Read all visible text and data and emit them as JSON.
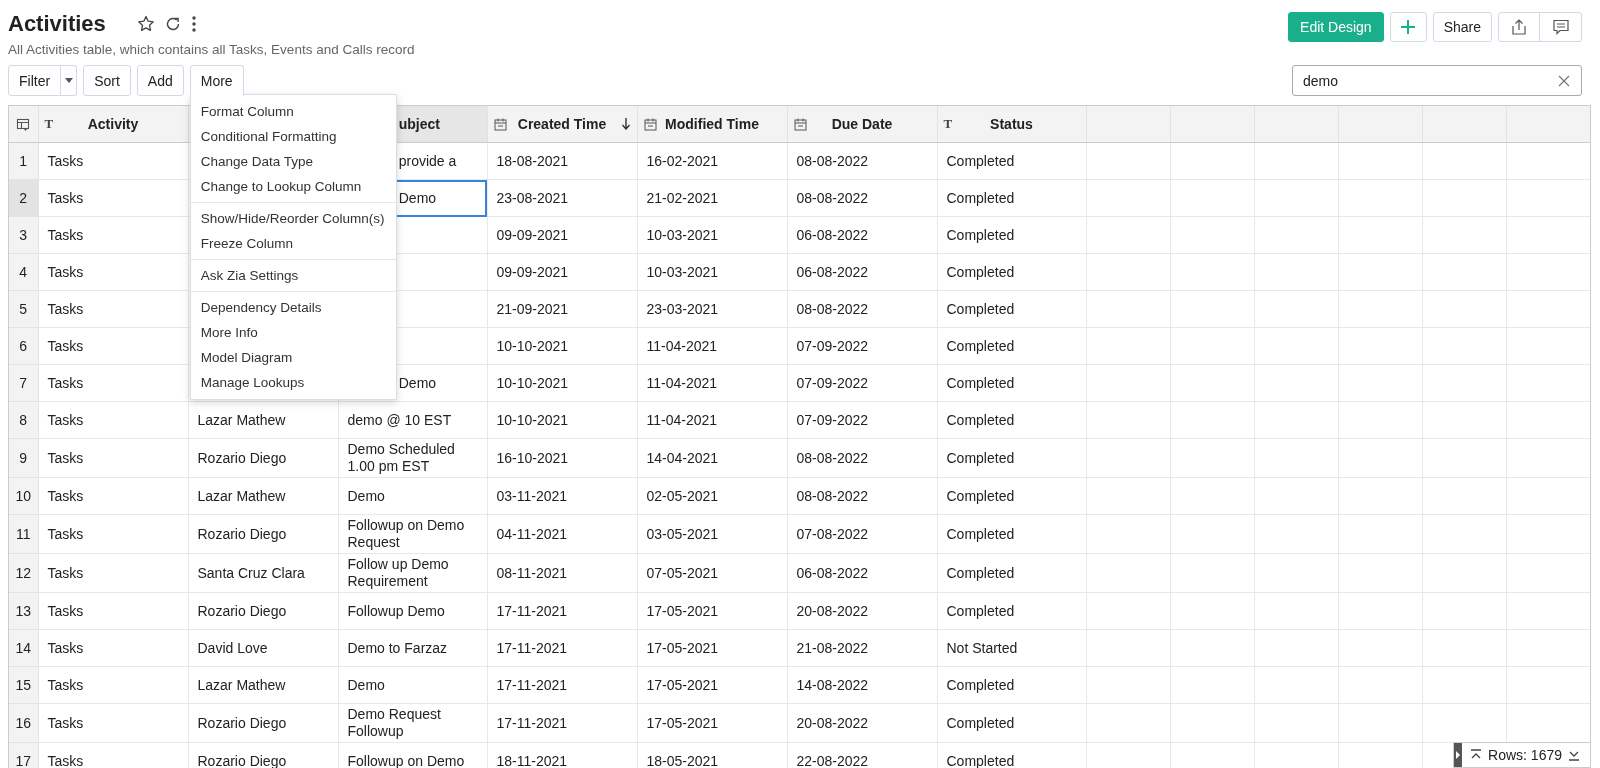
{
  "page": {
    "title": "Activities",
    "subtitle": "All Activities table, which contains all Tasks, Events and Calls record"
  },
  "header_buttons": {
    "edit_design": "Edit Design",
    "share": "Share"
  },
  "toolbar": {
    "buttons": [
      {
        "label": "Filter",
        "kind": "split",
        "open": false
      },
      {
        "label": "Sort",
        "kind": "plain",
        "open": false
      },
      {
        "label": "Add",
        "kind": "plain",
        "open": false
      },
      {
        "label": "More",
        "kind": "plain",
        "open": true
      }
    ],
    "search": {
      "value": "demo"
    }
  },
  "more_menu": {
    "groups": [
      [
        "Format Column",
        "Conditional Formatting",
        "Change Data Type",
        "Change to Lookup Column"
      ],
      [
        "Show/Hide/Reorder Column(s)",
        "Freeze Column"
      ],
      [
        "Ask Zia Settings"
      ],
      [
        "Dependency Details",
        "More Info",
        "Model Diagram",
        "Manage Lookups"
      ]
    ]
  },
  "table": {
    "columns": [
      {
        "label": "Activity",
        "kind": "text",
        "type_glyph": "T",
        "selected": false
      },
      {
        "label": "ubject",
        "selected": true
      },
      {
        "label": "Created Time",
        "kind": "date",
        "selected": false,
        "sort_descending": true
      },
      {
        "label": "Modified Time",
        "kind": "date",
        "selected": false
      },
      {
        "label": "Due Date",
        "kind": "date",
        "selected": false
      },
      {
        "label": "Status",
        "kind": "text",
        "type_glyph": "T",
        "selected": false
      }
    ],
    "rows": [
      {
        "number": "1",
        "selected": false,
        "activity": "Tasks",
        "subject": "provide a",
        "created_time": "18-08-2021",
        "modified_time": "16-02-2021",
        "due_date": "08-08-2022",
        "status": "Completed"
      },
      {
        "number": "2",
        "selected": true,
        "activity": "Tasks",
        "subject": "Demo",
        "created_time": "23-08-2021",
        "modified_time": "21-02-2021",
        "due_date": "08-08-2022",
        "status": "Completed"
      },
      {
        "number": "3",
        "selected": false,
        "activity": "Tasks",
        "created_time": "09-09-2021",
        "modified_time": "10-03-2021",
        "due_date": "06-08-2022",
        "status": "Completed"
      },
      {
        "number": "4",
        "selected": false,
        "activity": "Tasks",
        "created_time": "09-09-2021",
        "modified_time": "10-03-2021",
        "due_date": "06-08-2022",
        "status": "Completed"
      },
      {
        "number": "5",
        "selected": false,
        "activity": "Tasks",
        "created_time": "21-09-2021",
        "modified_time": "23-03-2021",
        "due_date": "08-08-2022",
        "status": "Completed"
      },
      {
        "number": "6",
        "selected": false,
        "activity": "Tasks",
        "created_time": "10-10-2021",
        "modified_time": "11-04-2021",
        "due_date": "07-09-2022",
        "status": "Completed"
      },
      {
        "number": "7",
        "selected": false,
        "activity": "Tasks",
        "subject": "Demo",
        "created_time": "10-10-2021",
        "modified_time": "11-04-2021",
        "due_date": "07-09-2022",
        "status": "Completed"
      },
      {
        "number": "8",
        "selected": false,
        "activity": "Tasks",
        "column_3": "Lazar Mathew",
        "subject": "demo @ 10 EST",
        "created_time": "10-10-2021",
        "modified_time": "11-04-2021",
        "due_date": "07-09-2022",
        "status": "Completed"
      },
      {
        "number": "9",
        "selected": false,
        "activity": "Tasks",
        "column_3": "Rozario Diego",
        "subject": "Demo Scheduled 1.00 pm EST",
        "created_time": "16-10-2021",
        "modified_time": "14-04-2021",
        "due_date": "08-08-2022",
        "status": "Completed"
      },
      {
        "number": "10",
        "selected": false,
        "activity": "Tasks",
        "column_3": "Lazar Mathew",
        "subject": "Demo",
        "created_time": "03-11-2021",
        "modified_time": "02-05-2021",
        "due_date": "08-08-2022",
        "status": "Completed"
      },
      {
        "number": "11",
        "selected": false,
        "activity": "Tasks",
        "column_3": "Rozario Diego",
        "subject": "Followup on Demo Request",
        "created_time": "04-11-2021",
        "modified_time": "03-05-2021",
        "due_date": "07-08-2022",
        "status": "Completed"
      },
      {
        "number": "12",
        "selected": false,
        "activity": "Tasks",
        "column_3": "Santa Cruz Clara",
        "subject": "Follow up Demo Requirement",
        "created_time": "08-11-2021",
        "modified_time": "07-05-2021",
        "due_date": "06-08-2022",
        "status": "Completed"
      },
      {
        "number": "13",
        "selected": false,
        "activity": "Tasks",
        "column_3": "Rozario Diego",
        "subject": "Followup Demo",
        "created_time": "17-11-2021",
        "modified_time": "17-05-2021",
        "due_date": "20-08-2022",
        "status": "Completed"
      },
      {
        "number": "14",
        "selected": false,
        "activity": "Tasks",
        "column_3": "David Love",
        "subject": "Demo to Farzaz",
        "created_time": "17-11-2021",
        "modified_time": "17-05-2021",
        "due_date": "21-08-2022",
        "status": "Not Started"
      },
      {
        "number": "15",
        "selected": false,
        "activity": "Tasks",
        "column_3": "Lazar Mathew",
        "subject": "Demo",
        "created_time": "17-11-2021",
        "modified_time": "17-05-2021",
        "due_date": "14-08-2022",
        "status": "Completed"
      },
      {
        "number": "16",
        "selected": false,
        "activity": "Tasks",
        "column_3": "Rozario Diego",
        "subject": "Demo Request Followup",
        "created_time": "17-11-2021",
        "modified_time": "17-05-2021",
        "due_date": "20-08-2022",
        "status": "Completed"
      },
      {
        "number": "17",
        "selected": false,
        "activity": "Tasks",
        "column_3": "Rozario Diego",
        "subject": "Followup on Demo",
        "created_time": "18-11-2021",
        "modified_time": "18-05-2021",
        "due_date": "22-08-2022",
        "status": "Completed"
      }
    ]
  },
  "row_counter": "Rows: 1679"
}
